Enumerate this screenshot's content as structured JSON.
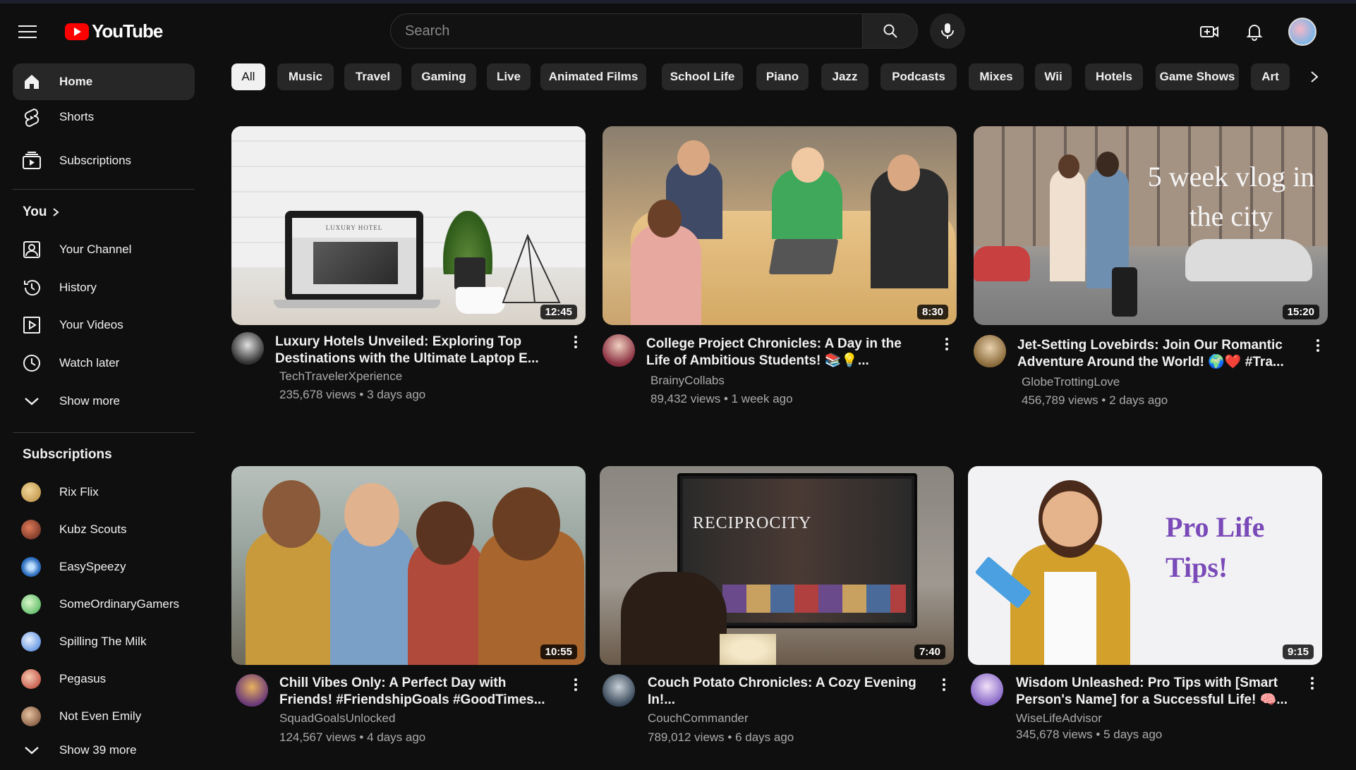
{
  "header": {
    "logo_text": "YouTube",
    "search_placeholder": "Search"
  },
  "sidebar": {
    "main": [
      {
        "label": "Home",
        "icon": "home-icon"
      },
      {
        "label": "Shorts",
        "icon": "shorts-icon"
      },
      {
        "label": "Subscriptions",
        "icon": "subscriptions-icon"
      }
    ],
    "you_heading": "You",
    "you_items": [
      {
        "label": "Your Channel",
        "icon": "channel-icon"
      },
      {
        "label": "History",
        "icon": "history-icon"
      },
      {
        "label": "Your Videos",
        "icon": "your-videos-icon"
      },
      {
        "label": "Watch later",
        "icon": "watch-later-icon"
      },
      {
        "label": "Show more",
        "icon": "chevron-down-icon"
      }
    ],
    "subscriptions_heading": "Subscriptions",
    "subscriptions": [
      {
        "label": "Rix Flix",
        "color": "#c9a25a"
      },
      {
        "label": "Kubz Scouts",
        "color": "#8a3a2a"
      },
      {
        "label": "EasySpeezy",
        "color": "#3d7fd6"
      },
      {
        "label": "SomeOrdinaryGamers",
        "color": "#5fbf6a"
      },
      {
        "label": "Spilling The Milk",
        "color": "#4a8be0"
      },
      {
        "label": "Pegasus",
        "color": "#c8463c"
      },
      {
        "label": "Not Even Emily",
        "color": "#a06a4a"
      }
    ],
    "show_more_subs": "Show 39 more"
  },
  "chips": [
    "All",
    "Music",
    "Travel",
    "Gaming",
    "Live",
    "Animated Films",
    "School Life",
    "Piano",
    "Jazz",
    "Podcasts",
    "Mixes",
    "Wii",
    "Hotels",
    "Game Shows",
    "Art"
  ],
  "videos": [
    {
      "title": "Luxury Hotels Unveiled: Exploring Top Destinations with the Ultimate Laptop E...",
      "channel": "TechTravelerXperience",
      "meta": "235,678 views • 3 days ago",
      "duration": "12:45",
      "thumb_overlay": "LUXURY HOTEL"
    },
    {
      "title": "College Project Chronicles: A Day in the Life of Ambitious Students! 📚💡...",
      "channel": "BrainyCollabs",
      "meta": "89,432 views • 1 week ago",
      "duration": "8:30"
    },
    {
      "title": "Jet-Setting Lovebirds: Join Our Romantic Adventure Around the World! 🌍❤️ #Tra...",
      "channel": "GlobeTrottingLove",
      "meta": "456,789 views • 2 days ago",
      "duration": "15:20",
      "thumb_overlay": "5 week vlog in the city"
    },
    {
      "title": "Chill Vibes Only: A Perfect Day with Friends! #FriendshipGoals #GoodTimes...",
      "channel": "SquadGoalsUnlocked",
      "meta": "124,567 views • 4 days ago",
      "duration": "10:55"
    },
    {
      "title": "Couch Potato Chronicles: A Cozy Evening In!...",
      "channel": "CouchCommander",
      "meta": "789,012 views • 6 days ago",
      "duration": "7:40",
      "thumb_overlay": "RECIPROCITY"
    },
    {
      "title": "Wisdom Unleashed: Pro Tips with [Smart Person's Name] for a Successful Life! 🧠...",
      "channel": "WiseLifeAdvisor",
      "meta": "345,678 views • 5 days ago",
      "duration": "9:15",
      "thumb_overlay": "Pro Life Tips!"
    }
  ]
}
